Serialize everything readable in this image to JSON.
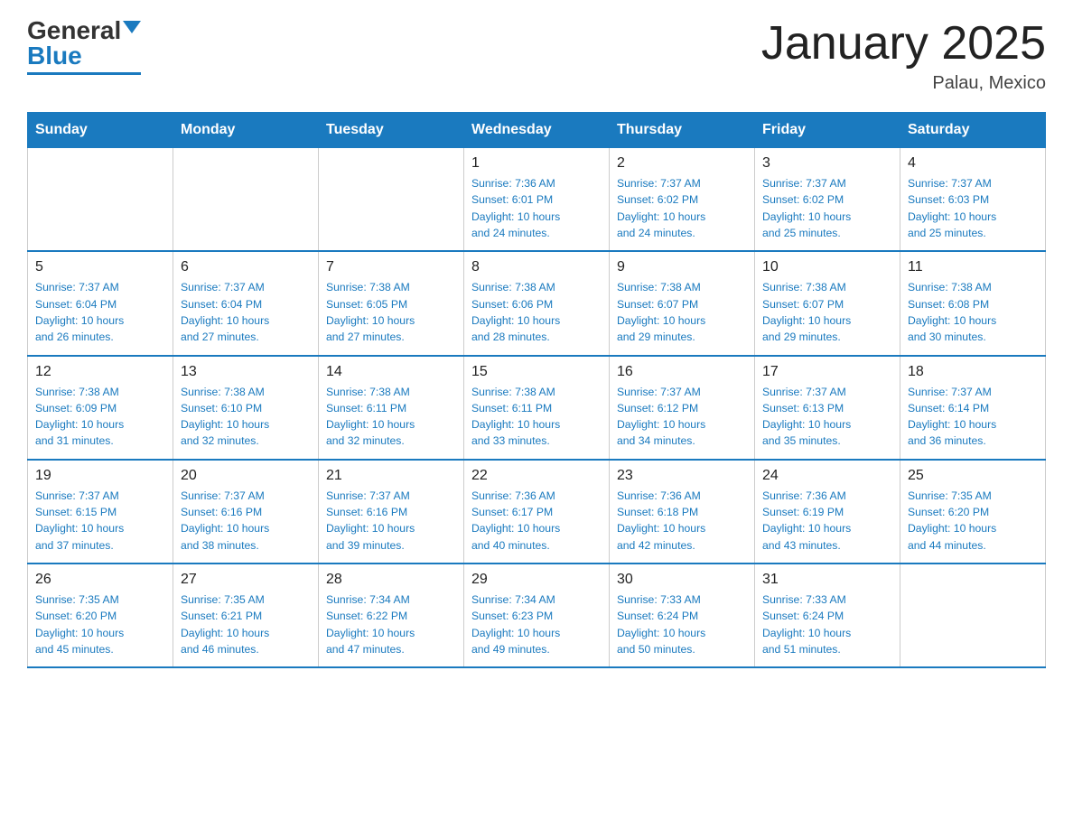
{
  "header": {
    "logo_general": "General",
    "logo_blue": "Blue",
    "title": "January 2025",
    "subtitle": "Palau, Mexico"
  },
  "days_of_week": [
    "Sunday",
    "Monday",
    "Tuesday",
    "Wednesday",
    "Thursday",
    "Friday",
    "Saturday"
  ],
  "weeks": [
    [
      {
        "day": "",
        "info": ""
      },
      {
        "day": "",
        "info": ""
      },
      {
        "day": "",
        "info": ""
      },
      {
        "day": "1",
        "info": "Sunrise: 7:36 AM\nSunset: 6:01 PM\nDaylight: 10 hours\nand 24 minutes."
      },
      {
        "day": "2",
        "info": "Sunrise: 7:37 AM\nSunset: 6:02 PM\nDaylight: 10 hours\nand 24 minutes."
      },
      {
        "day": "3",
        "info": "Sunrise: 7:37 AM\nSunset: 6:02 PM\nDaylight: 10 hours\nand 25 minutes."
      },
      {
        "day": "4",
        "info": "Sunrise: 7:37 AM\nSunset: 6:03 PM\nDaylight: 10 hours\nand 25 minutes."
      }
    ],
    [
      {
        "day": "5",
        "info": "Sunrise: 7:37 AM\nSunset: 6:04 PM\nDaylight: 10 hours\nand 26 minutes."
      },
      {
        "day": "6",
        "info": "Sunrise: 7:37 AM\nSunset: 6:04 PM\nDaylight: 10 hours\nand 27 minutes."
      },
      {
        "day": "7",
        "info": "Sunrise: 7:38 AM\nSunset: 6:05 PM\nDaylight: 10 hours\nand 27 minutes."
      },
      {
        "day": "8",
        "info": "Sunrise: 7:38 AM\nSunset: 6:06 PM\nDaylight: 10 hours\nand 28 minutes."
      },
      {
        "day": "9",
        "info": "Sunrise: 7:38 AM\nSunset: 6:07 PM\nDaylight: 10 hours\nand 29 minutes."
      },
      {
        "day": "10",
        "info": "Sunrise: 7:38 AM\nSunset: 6:07 PM\nDaylight: 10 hours\nand 29 minutes."
      },
      {
        "day": "11",
        "info": "Sunrise: 7:38 AM\nSunset: 6:08 PM\nDaylight: 10 hours\nand 30 minutes."
      }
    ],
    [
      {
        "day": "12",
        "info": "Sunrise: 7:38 AM\nSunset: 6:09 PM\nDaylight: 10 hours\nand 31 minutes."
      },
      {
        "day": "13",
        "info": "Sunrise: 7:38 AM\nSunset: 6:10 PM\nDaylight: 10 hours\nand 32 minutes."
      },
      {
        "day": "14",
        "info": "Sunrise: 7:38 AM\nSunset: 6:11 PM\nDaylight: 10 hours\nand 32 minutes."
      },
      {
        "day": "15",
        "info": "Sunrise: 7:38 AM\nSunset: 6:11 PM\nDaylight: 10 hours\nand 33 minutes."
      },
      {
        "day": "16",
        "info": "Sunrise: 7:37 AM\nSunset: 6:12 PM\nDaylight: 10 hours\nand 34 minutes."
      },
      {
        "day": "17",
        "info": "Sunrise: 7:37 AM\nSunset: 6:13 PM\nDaylight: 10 hours\nand 35 minutes."
      },
      {
        "day": "18",
        "info": "Sunrise: 7:37 AM\nSunset: 6:14 PM\nDaylight: 10 hours\nand 36 minutes."
      }
    ],
    [
      {
        "day": "19",
        "info": "Sunrise: 7:37 AM\nSunset: 6:15 PM\nDaylight: 10 hours\nand 37 minutes."
      },
      {
        "day": "20",
        "info": "Sunrise: 7:37 AM\nSunset: 6:16 PM\nDaylight: 10 hours\nand 38 minutes."
      },
      {
        "day": "21",
        "info": "Sunrise: 7:37 AM\nSunset: 6:16 PM\nDaylight: 10 hours\nand 39 minutes."
      },
      {
        "day": "22",
        "info": "Sunrise: 7:36 AM\nSunset: 6:17 PM\nDaylight: 10 hours\nand 40 minutes."
      },
      {
        "day": "23",
        "info": "Sunrise: 7:36 AM\nSunset: 6:18 PM\nDaylight: 10 hours\nand 42 minutes."
      },
      {
        "day": "24",
        "info": "Sunrise: 7:36 AM\nSunset: 6:19 PM\nDaylight: 10 hours\nand 43 minutes."
      },
      {
        "day": "25",
        "info": "Sunrise: 7:35 AM\nSunset: 6:20 PM\nDaylight: 10 hours\nand 44 minutes."
      }
    ],
    [
      {
        "day": "26",
        "info": "Sunrise: 7:35 AM\nSunset: 6:20 PM\nDaylight: 10 hours\nand 45 minutes."
      },
      {
        "day": "27",
        "info": "Sunrise: 7:35 AM\nSunset: 6:21 PM\nDaylight: 10 hours\nand 46 minutes."
      },
      {
        "day": "28",
        "info": "Sunrise: 7:34 AM\nSunset: 6:22 PM\nDaylight: 10 hours\nand 47 minutes."
      },
      {
        "day": "29",
        "info": "Sunrise: 7:34 AM\nSunset: 6:23 PM\nDaylight: 10 hours\nand 49 minutes."
      },
      {
        "day": "30",
        "info": "Sunrise: 7:33 AM\nSunset: 6:24 PM\nDaylight: 10 hours\nand 50 minutes."
      },
      {
        "day": "31",
        "info": "Sunrise: 7:33 AM\nSunset: 6:24 PM\nDaylight: 10 hours\nand 51 minutes."
      },
      {
        "day": "",
        "info": ""
      }
    ]
  ]
}
